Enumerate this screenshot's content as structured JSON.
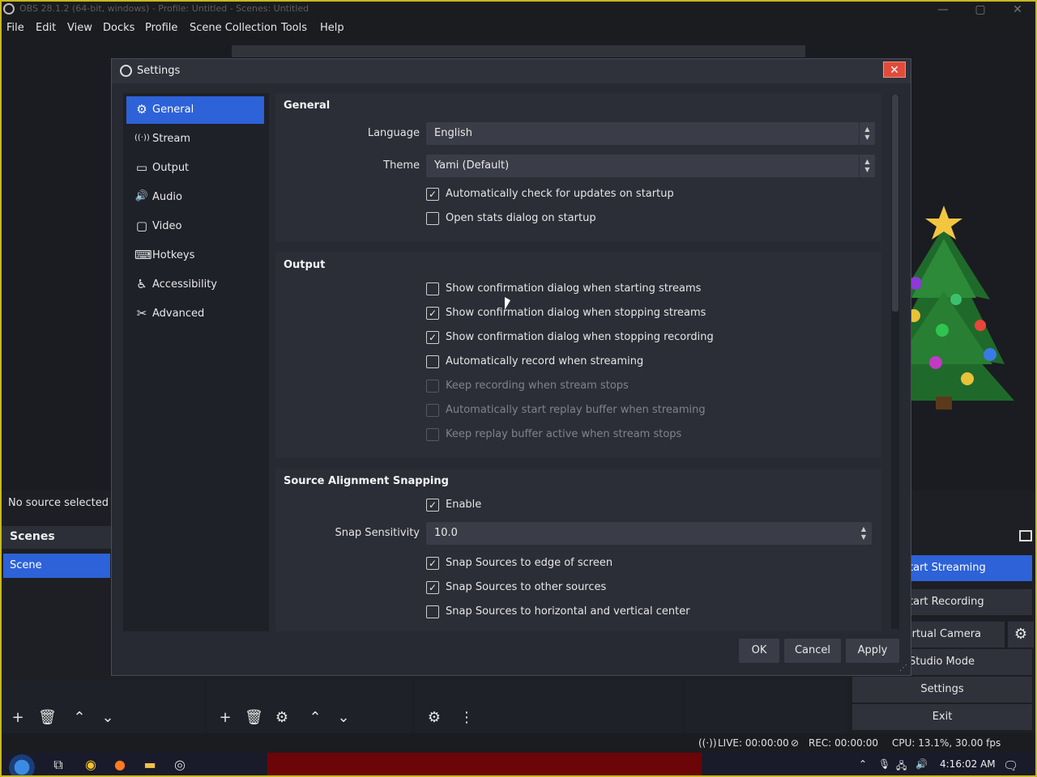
{
  "main_window": {
    "title": "OBS 28.1.2 (64-bit, windows) - Profile: Untitled - Scenes: Untitled",
    "controls": {
      "minimize": "—",
      "maximize": "▢",
      "close": "✕"
    }
  },
  "menubar": [
    "File",
    "Edit",
    "View",
    "Docks",
    "Profile",
    "Scene Collection",
    "Tools",
    "Help"
  ],
  "preview": {
    "no_source": "No source selected"
  },
  "scenes": {
    "header": "Scenes",
    "items": [
      "Scene"
    ]
  },
  "controls_dock": {
    "start_streaming": "tart Streaming",
    "start_recording": "tart Recording",
    "virtual_camera": "irtual Camera",
    "studio_mode": "Studio Mode",
    "settings": "Settings",
    "exit": "Exit"
  },
  "statusbar": {
    "live": "LIVE: 00:00:00",
    "rec": "REC: 00:00:00",
    "cpu": "CPU: 13.1%, 30.00 fps"
  },
  "taskbar": {
    "clock": "4:16:02 AM"
  },
  "settings": {
    "title": "Settings",
    "close": "✕",
    "nav": [
      {
        "label": "General",
        "icon": "gear-icon",
        "glyph": "⚙",
        "active": true
      },
      {
        "label": "Stream",
        "icon": "antenna-icon",
        "glyph": "((·))",
        "active": false
      },
      {
        "label": "Output",
        "icon": "monitor-output-icon",
        "glyph": "▭",
        "active": false
      },
      {
        "label": "Audio",
        "icon": "speaker-icon",
        "glyph": "🔊",
        "active": false
      },
      {
        "label": "Video",
        "icon": "display-icon",
        "glyph": "▢",
        "active": false
      },
      {
        "label": "Hotkeys",
        "icon": "keyboard-icon",
        "glyph": "⌨",
        "active": false
      },
      {
        "label": "Accessibility",
        "icon": "accessibility-icon",
        "glyph": "♿",
        "active": false
      },
      {
        "label": "Advanced",
        "icon": "tools-icon",
        "glyph": "✂",
        "active": false
      }
    ],
    "general": {
      "title": "General",
      "language_label": "Language",
      "language_value": "English",
      "theme_label": "Theme",
      "theme_value": "Yami (Default)",
      "check_updates": {
        "label": "Automatically check for updates on startup",
        "checked": true
      },
      "open_stats": {
        "label": "Open stats dialog on startup",
        "checked": false
      }
    },
    "output": {
      "title": "Output",
      "items": [
        {
          "label": "Show confirmation dialog when starting streams",
          "checked": false,
          "disabled": false
        },
        {
          "label": "Show confirmation dialog when stopping streams",
          "checked": true,
          "disabled": false
        },
        {
          "label": "Show confirmation dialog when stopping recording",
          "checked": true,
          "disabled": false
        },
        {
          "label": "Automatically record when streaming",
          "checked": false,
          "disabled": false
        },
        {
          "label": "Keep recording when stream stops",
          "checked": false,
          "disabled": true
        },
        {
          "label": "Automatically start replay buffer when streaming",
          "checked": false,
          "disabled": true
        },
        {
          "label": "Keep replay buffer active when stream stops",
          "checked": false,
          "disabled": true
        }
      ]
    },
    "snapping": {
      "title": "Source Alignment Snapping",
      "enable": {
        "label": "Enable",
        "checked": true
      },
      "sensitivity_label": "Snap Sensitivity",
      "sensitivity_value": "10.0",
      "edge": {
        "label": "Snap Sources to edge of screen",
        "checked": true
      },
      "other": {
        "label": "Snap Sources to other sources",
        "checked": true
      },
      "center": {
        "label": "Snap Sources to horizontal and vertical center",
        "checked": false
      }
    },
    "buttons": {
      "ok": "OK",
      "cancel": "Cancel",
      "apply": "Apply"
    }
  },
  "colors": {
    "accent": "#2d62d8",
    "close_button": "#e04b3a",
    "dialog_bg": "#272a33"
  }
}
